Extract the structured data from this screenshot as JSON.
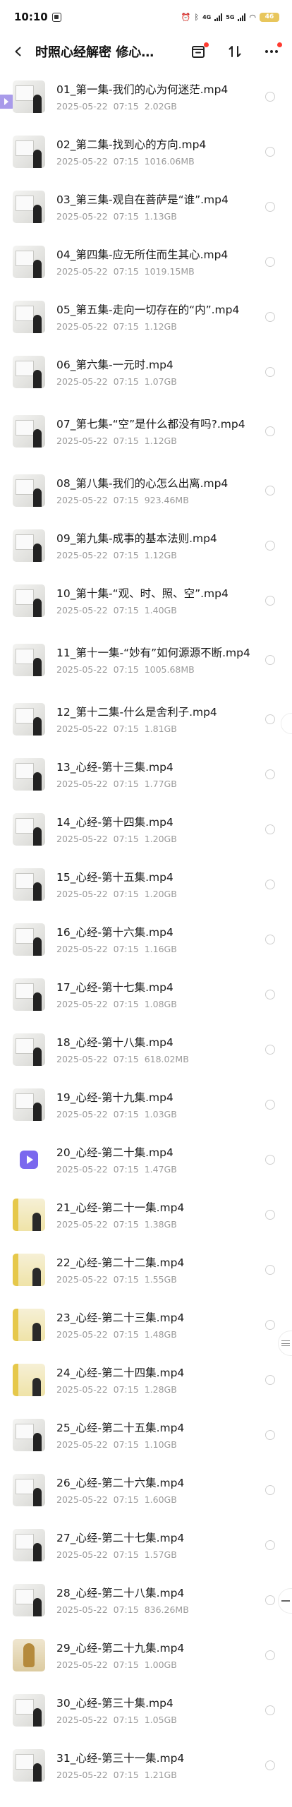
{
  "status": {
    "time": "10:10",
    "network_a": "4G",
    "network_b": "5G",
    "battery": "46"
  },
  "nav": {
    "title": "时照心经解密 修心…"
  },
  "files": [
    {
      "name": "01_第一集-我们的心为何迷茫.mp4",
      "date": "2025-05-22",
      "time": "07:15",
      "size": "2.02GB",
      "thumb": "board"
    },
    {
      "name": "02_第二集-找到心的方向.mp4",
      "date": "2025-05-22",
      "time": "07:15",
      "size": "1016.06MB",
      "thumb": "board"
    },
    {
      "name": "03_第三集-观自在菩萨是“谁”.mp4",
      "date": "2025-05-22",
      "time": "07:15",
      "size": "1.13GB",
      "thumb": "board"
    },
    {
      "name": "04_第四集-应无所住而生其心.mp4",
      "date": "2025-05-22",
      "time": "07:15",
      "size": "1019.15MB",
      "thumb": "board"
    },
    {
      "name": "05_第五集-走向一切存在的“内”.mp4",
      "date": "2025-05-22",
      "time": "07:15",
      "size": "1.12GB",
      "thumb": "board"
    },
    {
      "name": "06_第六集-一元时.mp4",
      "date": "2025-05-22",
      "time": "07:15",
      "size": "1.07GB",
      "thumb": "board"
    },
    {
      "name": "07_第七集-“空”是什么都没有吗?.mp4",
      "date": "2025-05-22",
      "time": "07:15",
      "size": "1.12GB",
      "thumb": "board",
      "tall": true
    },
    {
      "name": "08_第八集-我们的心怎么出离.mp4",
      "date": "2025-05-22",
      "time": "07:15",
      "size": "923.46MB",
      "thumb": "board"
    },
    {
      "name": "09_第九集-成事的基本法则.mp4",
      "date": "2025-05-22",
      "time": "07:15",
      "size": "1.12GB",
      "thumb": "board"
    },
    {
      "name": "10_第十集-“观、时、照、空”.mp4",
      "date": "2025-05-22",
      "time": "07:15",
      "size": "1.40GB",
      "thumb": "board"
    },
    {
      "name": "11_第十一集-“妙有”如何源源不断.mp4",
      "date": "2025-05-22",
      "time": "07:15",
      "size": "1005.68MB",
      "thumb": "board",
      "tall": true
    },
    {
      "name": "12_第十二集-什么是舍利子.mp4",
      "date": "2025-05-22",
      "time": "07:15",
      "size": "1.81GB",
      "thumb": "board"
    },
    {
      "name": "13_心经-第十三集.mp4",
      "date": "2025-05-22",
      "time": "07:15",
      "size": "1.77GB",
      "thumb": "board"
    },
    {
      "name": "14_心经-第十四集.mp4",
      "date": "2025-05-22",
      "time": "07:15",
      "size": "1.20GB",
      "thumb": "board"
    },
    {
      "name": "15_心经-第十五集.mp4",
      "date": "2025-05-22",
      "time": "07:15",
      "size": "1.20GB",
      "thumb": "board"
    },
    {
      "name": "16_心经-第十六集.mp4",
      "date": "2025-05-22",
      "time": "07:15",
      "size": "1.16GB",
      "thumb": "board"
    },
    {
      "name": "17_心经-第十七集.mp4",
      "date": "2025-05-22",
      "time": "07:15",
      "size": "1.08GB",
      "thumb": "board"
    },
    {
      "name": "18_心经-第十八集.mp4",
      "date": "2025-05-22",
      "time": "07:15",
      "size": "618.02MB",
      "thumb": "board"
    },
    {
      "name": "19_心经-第十九集.mp4",
      "date": "2025-05-22",
      "time": "07:15",
      "size": "1.03GB",
      "thumb": "board"
    },
    {
      "name": "20_心经-第二十集.mp4",
      "date": "2025-05-22",
      "time": "07:15",
      "size": "1.47GB",
      "thumb": "play"
    },
    {
      "name": "21_心经-第二十一集.mp4",
      "date": "2025-05-22",
      "time": "07:15",
      "size": "1.38GB",
      "thumb": "yellow"
    },
    {
      "name": "22_心经-第二十二集.mp4",
      "date": "2025-05-22",
      "time": "07:15",
      "size": "1.55GB",
      "thumb": "yellow"
    },
    {
      "name": "23_心经-第二十三集.mp4",
      "date": "2025-05-22",
      "time": "07:15",
      "size": "1.48GB",
      "thumb": "yellow"
    },
    {
      "name": "24_心经-第二十四集.mp4",
      "date": "2025-05-22",
      "time": "07:15",
      "size": "1.28GB",
      "thumb": "yellow"
    },
    {
      "name": "25_心经-第二十五集.mp4",
      "date": "2025-05-22",
      "time": "07:15",
      "size": "1.10GB",
      "thumb": "board"
    },
    {
      "name": "26_心经-第二十六集.mp4",
      "date": "2025-05-22",
      "time": "07:15",
      "size": "1.60GB",
      "thumb": "board"
    },
    {
      "name": "27_心经-第二十七集.mp4",
      "date": "2025-05-22",
      "time": "07:15",
      "size": "1.57GB",
      "thumb": "board"
    },
    {
      "name": "28_心经-第二十八集.mp4",
      "date": "2025-05-22",
      "time": "07:15",
      "size": "836.26MB",
      "thumb": "board"
    },
    {
      "name": "29_心经-第二十九集.mp4",
      "date": "2025-05-22",
      "time": "07:15",
      "size": "1.00GB",
      "thumb": "statue"
    },
    {
      "name": "30_心经-第三十集.mp4",
      "date": "2025-05-22",
      "time": "07:15",
      "size": "1.05GB",
      "thumb": "board"
    },
    {
      "name": "31_心经-第三十一集.mp4",
      "date": "2025-05-22",
      "time": "07:15",
      "size": "1.21GB",
      "thumb": "board"
    }
  ],
  "icons": {
    "back": "chevron-left-icon",
    "download": "download-box-icon",
    "sort": "sort-icon",
    "more": "more-icon",
    "radio": "radio-unchecked-icon"
  },
  "colors": {
    "accent": "#7b68ee",
    "badge_red": "#ff3b30",
    "meta_gray": "#9a9a9a"
  }
}
